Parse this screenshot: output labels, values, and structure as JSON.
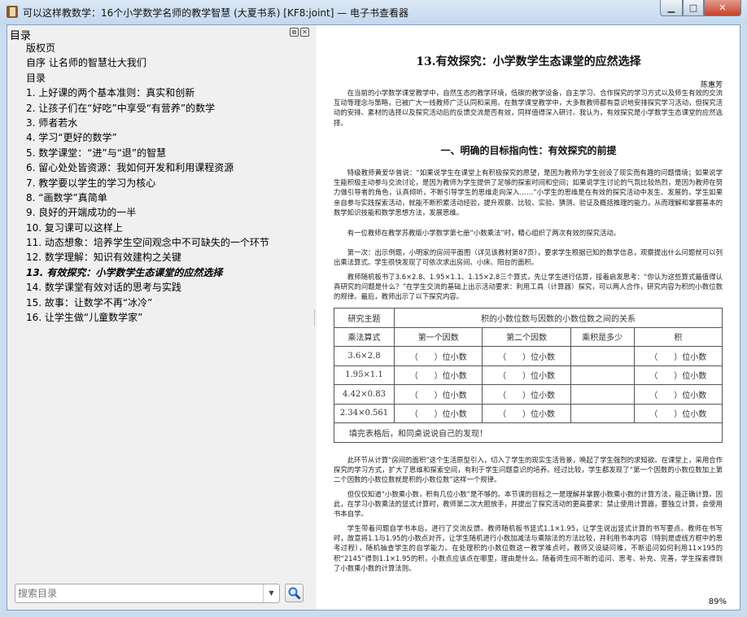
{
  "window": {
    "title": "可以这样教数学：16个小学数学名师的教学智慧 (大夏书系) [KF8:joint] — 电子书查看器",
    "minimize": "▁",
    "maximize": "□",
    "close": "✕"
  },
  "toc_panel": {
    "header": "目录",
    "float_btn": "⧉",
    "close_btn": "✕",
    "items": [
      "版权页",
      "自序 让名师的智慧壮大我们",
      "目录",
      "1. 上好课的两个基本准则：真实和创新",
      "2. 让孩子们在“好吃”中享受“有营养”的数学",
      "3. 师者若水",
      "4. 学习“更好的数学”",
      "5. 数学课堂：“进”与“退”的智慧",
      "6. 留心处处皆资源：我如何开发和利用课程资源",
      "7. 教学要以学生的学习为核心",
      "8. “画数学”真简单",
      "9. 良好的开端成功的一半",
      "10. 复习课可以这样上",
      "11. 动态想象：培养学生空间观念中不可缺失的一个环节",
      "12. 数学理解：知识有效建构之关键",
      "13. 有效探究：小学数学生态课堂的应然选择",
      "14. 数学课堂有效对话的思考与实践",
      "15. 故事：让数学不再“冰冷”",
      "16. 让学生做“儿童数学家”"
    ],
    "current_index": 15,
    "search_placeholder": "搜索目录",
    "dropdown_icon": "▼"
  },
  "document": {
    "title": "13.有效探究：小学数学生态课堂的应然选择",
    "author": "陈惠芳",
    "intro": "在当前的小学数学课堂教学中，自然生态的教学环境，低碳的教学设备，自主学习、合作探究的学习方式以及师生有效的交流互动等理念与策略，已被广大一线教师广泛认同和采用。在数学课堂教学中，大多数教师都有意识地安排探究学习活动，但探究活动的安排、素材的选择以及探究活动后的反馈交流是否有效，同样值得深入研讨。我认为，有效探究是小学数学生态课堂的应然选择。",
    "section1": "一、明确的目标指向性：有效探究的前提",
    "p1": "特级教师黄爱华曾说：“如果说学生在课堂上有积极探究的愿望，是因为教师为学生创设了现实而有趣的问题情境；如果说学生能积极主动参与交流讨论，是因为教师为学生提供了足够的探索时间和空间；如果说学生讨论的气氛比较热烈，是因为教师在努力做引导者的角色，认真倾听，不断引导学生的思维走向深入……”小学生的思维是在有效的探究活动中发生、发展的，学生如果亲自参与实践探索活动，就能不断积累活动经验，提升观察、比较、实验、猜测、验证及概括推理的能力，从而理解和掌握基本的数学知识技能和数学思想方法，发展思维。",
    "p2": "有一位教师在教学苏教版小学数学第七册“小数乘法”时，精心组织了两次有效的探究活动。",
    "p3": "第一次：出示例题，小明家的房间平面图（详见该教材第87页），要求学生根据已知的数学信息，观察提出什么问题就可以列出乘法算式。学生很快发现了可依次求出房间、小床、阳台的面积。",
    "p4": "教师随机板书了3.6×2.8、1.95×1.1、1.15×2.8三个算式，先让学生进行估算，接着启发思考：“你认为这些算式最值得认真研究的问题是什么？”在学生交流的基础上出示活动要求：利用工具（计算器）探究，可以两人合作，研究内容为积的小数位数的规律。最后，教师出示了以下探究内容。",
    "table": {
      "topic_label": "研究主题",
      "topic": "积的小数位数与因数的小数位数之间的关系",
      "headers": [
        "乘法算式",
        "第一个因数",
        "第二个因数",
        "乘积是多少",
        "积"
      ],
      "rows": [
        [
          "3.6×2.8",
          "（　　）位小数",
          "（　　）位小数",
          "",
          "（　　）位小数"
        ],
        [
          "1.95×1.1",
          "（　　）位小数",
          "（　　）位小数",
          "",
          "（　　）位小数"
        ],
        [
          "4.42×0.83",
          "（　　）位小数",
          "（　　）位小数",
          "",
          "（　　）位小数"
        ],
        [
          "2.34×0.561",
          "（　　）位小数",
          "（　　）位小数",
          "",
          "（　　）位小数"
        ]
      ],
      "footer": "填完表格后，和同桌说说自己的发现！"
    },
    "p5": "此环节从计算“房间的面积”这个生活原型引入，切入了学生的现实生活背景，唤起了学生强烈的求知欲。在课堂上，采用合作探究的学习方式，扩大了思维和探索空间，有利于学生问题意识的培养。经过比较，学生都发现了“第一个因数的小数位数加上第二个因数的小数位数就是积的小数位数”这样一个规律。",
    "p6": "但仅仅知道“小数乘小数，积有几位小数”是不够的。本节课的目标之一是理解并掌握小数乘小数的计算方法，能正确计算。因此，在学习小数乘法的竖式计算时，教师第二次大胆放手，并提出了探究活动的更高要求：禁止使用计算器，要独立计算，会使用书本自学。",
    "p7": "学生带着问题自学书本后，进行了交流反馈。教师随机板书竖式1.1×1.95，让学生说出竖式计算的书写要点。教师在书写时，故意将1.1与1.95的小数点对齐，让学生随机进行小数加减法与乘除法的方法比较，并利用书本内容（特别是虚线方框中的思考过程），随机抽查学生的自学能力。在处理积的小数位数这一教学难点时，教师又设疑问难，不断追问如何利用11×195的积“2145”得到1.1×1.95的积，小数点应该点在哪里，理由是什么。随着师生间不断的追问、思考、补充、完善，学生探索得到了小数乘小数的计算法则。",
    "zoom": "89%"
  }
}
